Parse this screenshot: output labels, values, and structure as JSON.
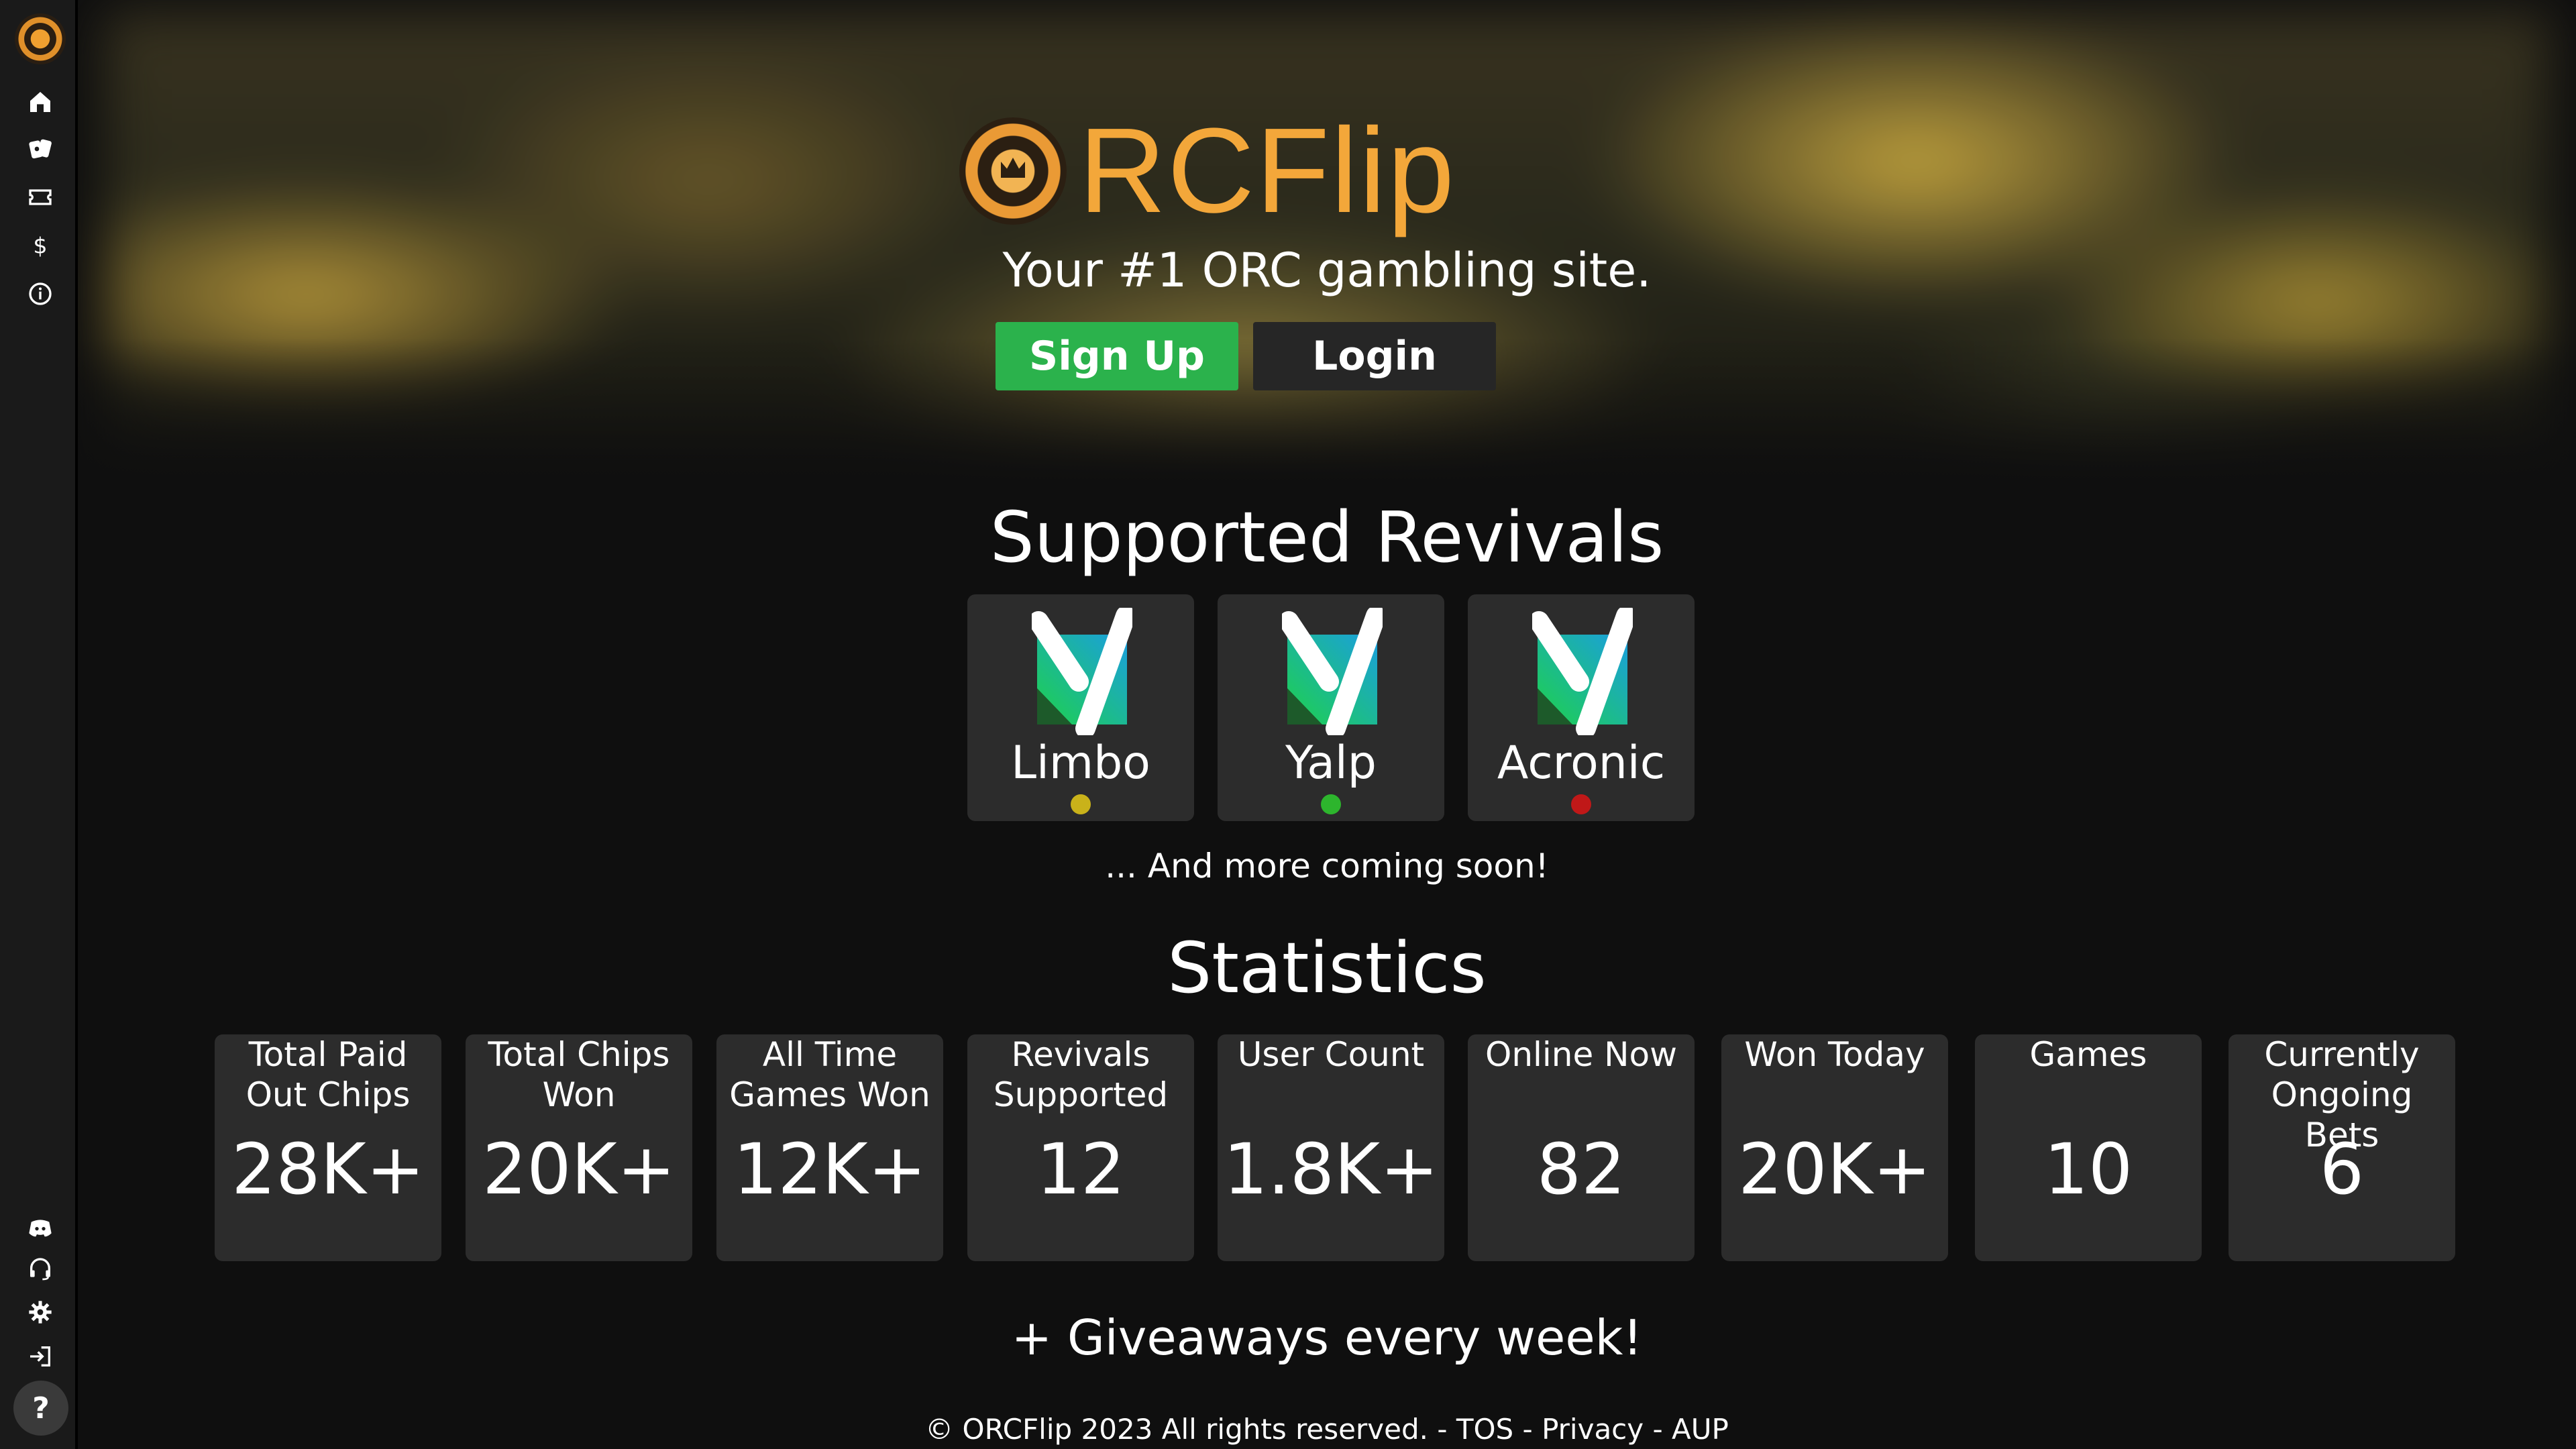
{
  "brand": {
    "name": "RCFlip",
    "tagline": "Your #1 ORC gambling site."
  },
  "buttons": {
    "signup": "Sign Up",
    "login": "Login"
  },
  "sidebar": {
    "top": [
      "home-icon",
      "cards-icon",
      "ticket-icon",
      "dollar-icon",
      "info-icon"
    ],
    "bottom": [
      "discord-icon",
      "headset-icon",
      "gear-icon",
      "logout-icon"
    ],
    "help": "?"
  },
  "revivals": {
    "title": "Supported Revivals",
    "items": [
      {
        "name": "Limbo",
        "status_color": "#c9b21a"
      },
      {
        "name": "Yalp",
        "status_color": "#2db52d"
      },
      {
        "name": "Acronic",
        "status_color": "#c01818"
      }
    ],
    "more": "... And more coming soon!"
  },
  "stats": {
    "title": "Statistics",
    "items": [
      {
        "label": "Total Paid Out Chips",
        "value": "28K+"
      },
      {
        "label": "Total Chips Won",
        "value": "20K+"
      },
      {
        "label": "All Time Games Won",
        "value": "12K+"
      },
      {
        "label": "Revivals Supported",
        "value": "12"
      },
      {
        "label": "User Count",
        "value": "1.8K+"
      },
      {
        "label": "Online Now",
        "value": "82"
      },
      {
        "label": "Won Today",
        "value": "20K+"
      },
      {
        "label": "Games",
        "value": "10"
      },
      {
        "label": "Currently Ongoing Bets",
        "value": "6"
      }
    ]
  },
  "giveaways": "+ Giveaways every week!",
  "footer": {
    "copyright": "© ORCFlip 2023 All rights reserved.",
    "sep": " - ",
    "tos": "TOS",
    "privacy": "Privacy",
    "aup": "AUP"
  },
  "colors": {
    "accent": "#f3a73a",
    "signup": "#2bb24c",
    "card": "#2c2c2c",
    "background": "#0f0f0f"
  }
}
